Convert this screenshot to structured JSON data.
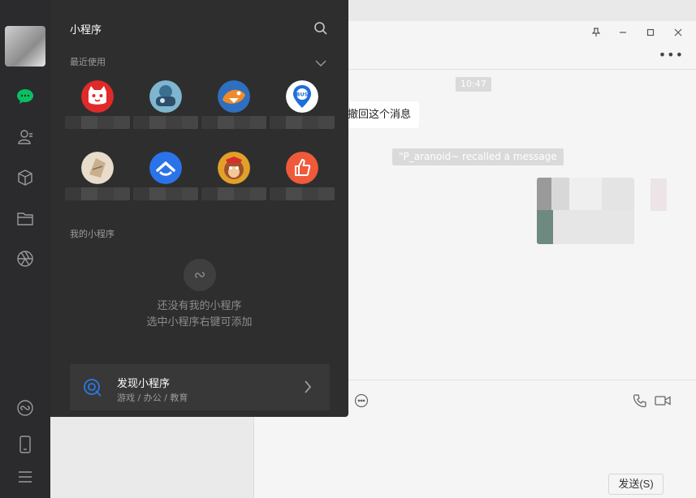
{
  "panel": {
    "title": "小程序",
    "recent_label": "最近使用",
    "mine_label": "我的小程序",
    "empty_line1": "还没有我的小程序",
    "empty_line2": "选中小程序右键可添加",
    "recent_apps": [
      {
        "icon": "cat-logo-icon",
        "color": "#e02a2a"
      },
      {
        "icon": "game-character-icon",
        "color": "#3a6f8f"
      },
      {
        "icon": "shark-game-icon",
        "color": "#2f6fc0"
      },
      {
        "icon": "bus-location-icon",
        "color": "#1e6fd9",
        "badge": "BUS"
      },
      {
        "icon": "paper-craft-icon",
        "color": "#c8b08f"
      },
      {
        "icon": "tencent-chevron-icon",
        "color": "#2b73e8"
      },
      {
        "icon": "monkey-game-icon",
        "color": "#e2a02a"
      },
      {
        "icon": "thumbs-up-icon",
        "color": "#f05a3a"
      }
    ],
    "discover": {
      "title": "发现小程序",
      "subtitle": "游戏 / 办公 / 教育"
    }
  },
  "chat": {
    "time": "10:47",
    "message_text": "撤回这个消息",
    "recall_notice": "\"P_aranoid~ recalled a message",
    "send_label": "发送(S)"
  },
  "colors": {
    "panel_bg": "#2e2e2e",
    "nav_bg": "#2b2b2d",
    "wechat_green": "#07c160",
    "discover_accent": "#2a7be4"
  }
}
